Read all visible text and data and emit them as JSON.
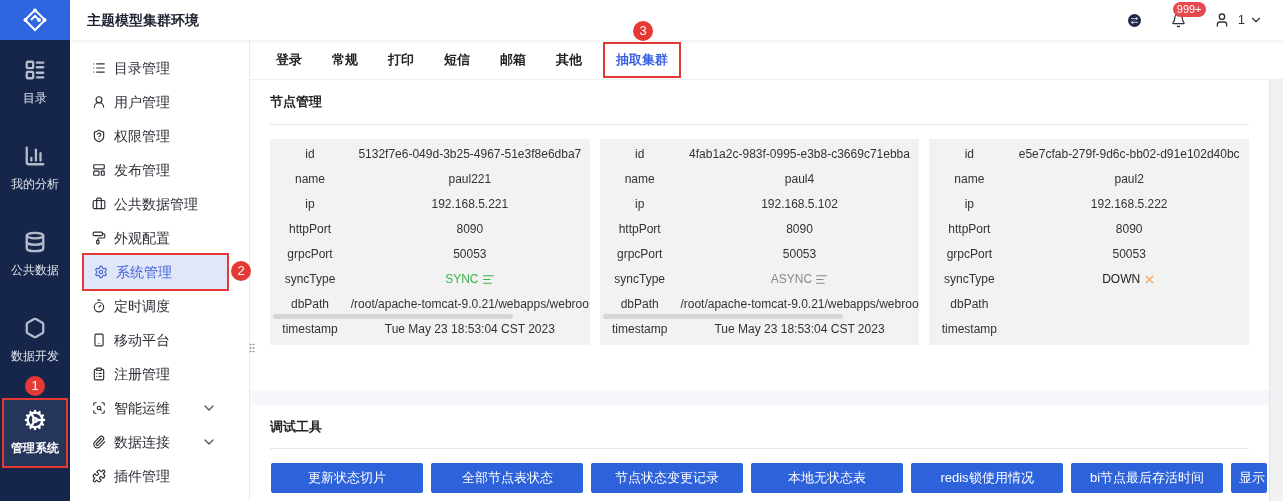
{
  "header": {
    "title": "主题模型集群环境",
    "notification_count": "999+",
    "user": "1"
  },
  "rail": [
    {
      "label": "目录",
      "selected": false
    },
    {
      "label": "我的分析",
      "selected": false
    },
    {
      "label": "公共数据",
      "selected": false
    },
    {
      "label": "数据开发",
      "selected": false
    },
    {
      "label": "管理系统",
      "selected": true,
      "callout": "1"
    }
  ],
  "menu": [
    {
      "label": "目录管理",
      "selected": false,
      "expandable": false
    },
    {
      "label": "用户管理",
      "selected": false,
      "expandable": false
    },
    {
      "label": "权限管理",
      "selected": false,
      "expandable": false
    },
    {
      "label": "发布管理",
      "selected": false,
      "expandable": false
    },
    {
      "label": "公共数据管理",
      "selected": false,
      "expandable": false
    },
    {
      "label": "外观配置",
      "selected": false,
      "expandable": false
    },
    {
      "label": "系统管理",
      "selected": true,
      "expandable": false,
      "callout": "2"
    },
    {
      "label": "定时调度",
      "selected": false,
      "expandable": false
    },
    {
      "label": "移动平台",
      "selected": false,
      "expandable": false
    },
    {
      "label": "注册管理",
      "selected": false,
      "expandable": false
    },
    {
      "label": "智能运维",
      "selected": false,
      "expandable": true
    },
    {
      "label": "数据连接",
      "selected": false,
      "expandable": true
    },
    {
      "label": "插件管理",
      "selected": false,
      "expandable": false
    }
  ],
  "tabs": [
    {
      "label": "登录",
      "selected": false
    },
    {
      "label": "常规",
      "selected": false
    },
    {
      "label": "打印",
      "selected": false
    },
    {
      "label": "短信",
      "selected": false
    },
    {
      "label": "邮箱",
      "selected": false
    },
    {
      "label": "其他",
      "selected": false
    },
    {
      "label": "抽取集群",
      "selected": true,
      "callout": "3"
    }
  ],
  "nodes_section": {
    "title": "节点管理",
    "nodes": [
      {
        "rows": [
          {
            "kind": "text",
            "label": "id",
            "value": "5132f7e6-049d-3b25-4967-51e3f8e6dba7"
          },
          {
            "kind": "text",
            "label": "name",
            "value": "paul221"
          },
          {
            "kind": "text",
            "label": "ip",
            "value": "192.168.5.221"
          },
          {
            "kind": "text",
            "label": "httpPort",
            "value": "8090"
          },
          {
            "kind": "text",
            "label": "grpcPort",
            "value": "50053"
          },
          {
            "kind": "synced",
            "label": "syncType",
            "value": "SYNC"
          },
          {
            "kind": "path",
            "label": "dbPath",
            "value": "/root/apache-tomcat-9.0.21/webapps/webroo"
          },
          {
            "kind": "text",
            "label": "timestamp",
            "value": "Tue May 23 18:53:04 CST 2023"
          }
        ]
      },
      {
        "rows": [
          {
            "kind": "text",
            "label": "id",
            "value": "4fab1a2c-983f-0995-e3b8-c3669c71ebba"
          },
          {
            "kind": "text",
            "label": "name",
            "value": "paul4"
          },
          {
            "kind": "text",
            "label": "ip",
            "value": "192.168.5.102"
          },
          {
            "kind": "text",
            "label": "httpPort",
            "value": "8090"
          },
          {
            "kind": "text",
            "label": "grpcPort",
            "value": "50053"
          },
          {
            "kind": "async",
            "label": "syncType",
            "value": "ASYNC"
          },
          {
            "kind": "path",
            "label": "dbPath",
            "value": "/root/apache-tomcat-9.0.21/webapps/webroo"
          },
          {
            "kind": "text",
            "label": "timestamp",
            "value": "Tue May 23 18:53:04 CST 2023"
          }
        ]
      },
      {
        "rows": [
          {
            "kind": "text",
            "label": "id",
            "value": "e5e7cfab-279f-9d6c-bb02-d91e102d40bc"
          },
          {
            "kind": "text",
            "label": "name",
            "value": "paul2"
          },
          {
            "kind": "text",
            "label": "ip",
            "value": "192.168.5.222"
          },
          {
            "kind": "text",
            "label": "httpPort",
            "value": "8090"
          },
          {
            "kind": "text",
            "label": "grpcPort",
            "value": "50053"
          },
          {
            "kind": "down",
            "label": "syncType",
            "value": "DOWN"
          },
          {
            "kind": "path",
            "label": "dbPath"
          },
          {
            "kind": "text",
            "label": "timestamp"
          }
        ]
      }
    ]
  },
  "debug_section": {
    "title": "调试工具",
    "buttons": [
      "更新状态切片",
      "全部节点表状态",
      "节点状态变更记录",
      "本地无状态表",
      "redis锁使用情况",
      "bi节点最后存活时间",
      "显示"
    ]
  }
}
